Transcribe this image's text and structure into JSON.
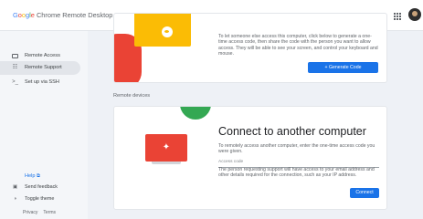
{
  "header": {
    "brand": [
      "G",
      "o",
      "o",
      "g",
      "l",
      "e"
    ],
    "title_rest": " Chrome Remote Desktop",
    "apps_icon": "apps-grid-icon",
    "avatar": "account-avatar"
  },
  "sidebar": {
    "items": [
      {
        "label": "Remote Access",
        "icon": "monitor-icon"
      },
      {
        "label": "Remote Support",
        "icon": "people-icon"
      },
      {
        "label": "Set up via SSH",
        "icon": "terminal-icon"
      }
    ],
    "help": "Help ⧉",
    "send_feedback": "Send feedback",
    "toggle_theme": "Toggle theme",
    "privacy": "Privacy",
    "terms": "Terms"
  },
  "share_card": {
    "description": "To let someone else access this computer, click below to generate a one-time access code, then share the code with the person you want to allow access. They will be able to see your screen, and control your keyboard and mouse.",
    "button": "+ Generate Code"
  },
  "remote_devices_label": "Remote devices",
  "connect_card": {
    "title": "Connect to another computer",
    "description": "To remotely access another computer, enter the one-time access code you were given.",
    "code_label": "Access code",
    "code_value": "",
    "warning": "The person requesting support will have access to your email address and other details required for the connection, such as your IP address.",
    "button": "Connect"
  },
  "colors": {
    "accent": "#1a73e8",
    "red": "#ea4335",
    "yellow": "#fbbc05",
    "green": "#34a853"
  }
}
